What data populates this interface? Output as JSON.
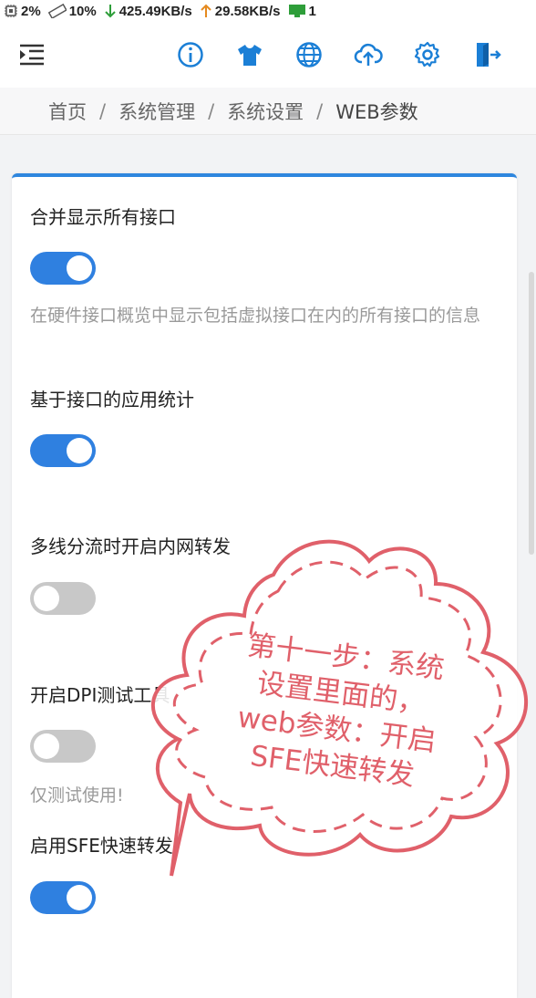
{
  "statusbar": {
    "cpu": "2%",
    "mem": "10%",
    "download": "425.49KB/s",
    "upload": "29.58KB/s",
    "devices": "1",
    "colors": {
      "down": "#2e9e3a",
      "up": "#e58a1f",
      "device": "#2e9e3a"
    }
  },
  "toolbar": {
    "menu_icon": "menu-collapse-icon",
    "icons": [
      "info-icon",
      "theme-shirt-icon",
      "language-globe-icon",
      "cloud-upload-icon",
      "settings-gear-icon",
      "logout-icon"
    ],
    "accent": "#1b7fd6"
  },
  "breadcrumb": {
    "items": [
      "首页",
      "系统管理",
      "系统设置",
      "WEB参数"
    ],
    "separator": "/"
  },
  "settings": [
    {
      "label": "合并显示所有接口",
      "enabled": true,
      "desc": "在硬件接口概览中显示包括虚拟接口在内的所有接口的信息"
    },
    {
      "label": "基于接口的应用统计",
      "enabled": true,
      "desc": ""
    },
    {
      "label": "多线分流时开启内网转发",
      "enabled": false,
      "desc": ""
    },
    {
      "label": "开启DPI测试工具",
      "enabled": false,
      "desc": "仅测试使用!"
    },
    {
      "label": "启用SFE快速转发",
      "enabled": true,
      "desc": ""
    }
  ],
  "annotation": {
    "lines": [
      "第十一步：系统",
      "设置里面的，",
      "web参数：开启",
      "SFE快速转发"
    ],
    "color": "#e0606a"
  }
}
